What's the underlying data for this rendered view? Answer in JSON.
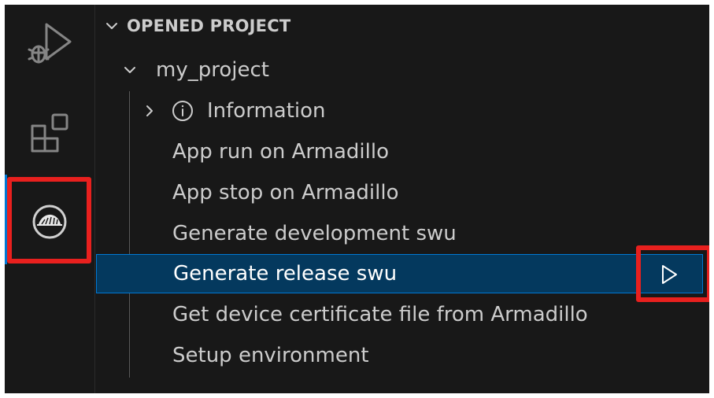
{
  "explorer": {
    "section_title": "OPENED PROJECT",
    "project_name": "my_project",
    "info_label": "Information",
    "commands": [
      "App run on Armadillo",
      "App stop on Armadillo",
      "Generate development swu",
      "Generate release swu",
      "Get device certificate file from Armadillo",
      "Setup environment"
    ],
    "selected_command_index": 3
  },
  "activity_bar": {
    "items": [
      "run-and-debug-icon",
      "extensions-icon",
      "armadillo-icon"
    ],
    "active": "armadillo-icon"
  },
  "colors": {
    "background": "#181818",
    "text": "#cccccc",
    "selection_bg": "#04395e",
    "selection_border": "#0078d4",
    "highlight": "#e8201e"
  }
}
